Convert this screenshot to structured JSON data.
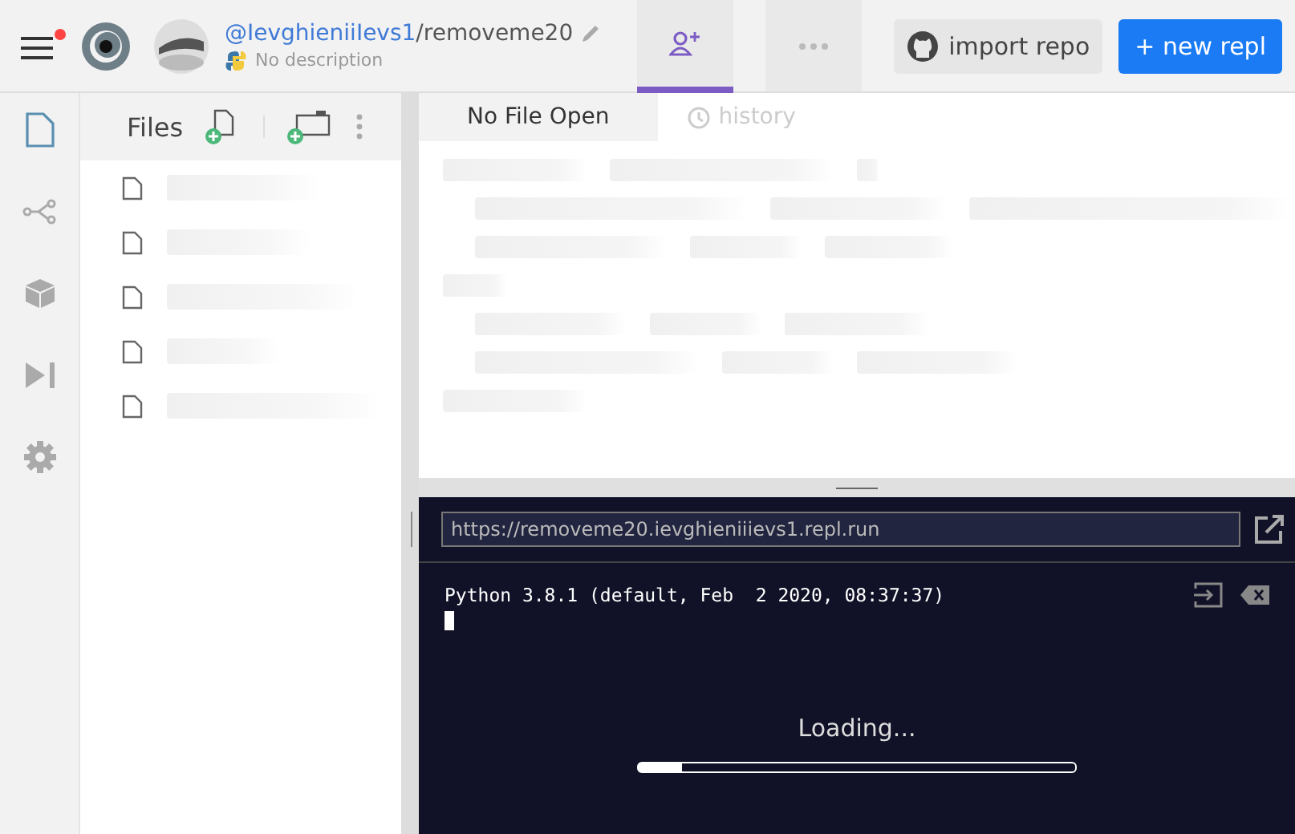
{
  "header": {
    "owner": "@IevghieniiIevs1",
    "separator": "/",
    "repl_name": "removeme20",
    "description": "No description",
    "notification": true,
    "import_button": "import repo",
    "new_button": "+ new repl",
    "invite_selected": true
  },
  "rail": [
    {
      "kind": "files",
      "selected": true
    },
    {
      "kind": "share",
      "selected": false
    },
    {
      "kind": "packages",
      "selected": false
    },
    {
      "kind": "debug",
      "selected": false
    },
    {
      "kind": "settings",
      "selected": false
    }
  ],
  "files": {
    "title": "Files"
  },
  "editor_tabs": [
    {
      "label": "No File Open",
      "kind": "file",
      "selected": true
    },
    {
      "label": "history",
      "kind": "history",
      "selected": false
    }
  ],
  "console": {
    "url": "https://removeme20.ievghieniiievs1.repl.run",
    "output": "Python 3.8.1 (default, Feb  2 2020, 08:37:37)",
    "loading": "Loading...",
    "level": 0.1
  }
}
